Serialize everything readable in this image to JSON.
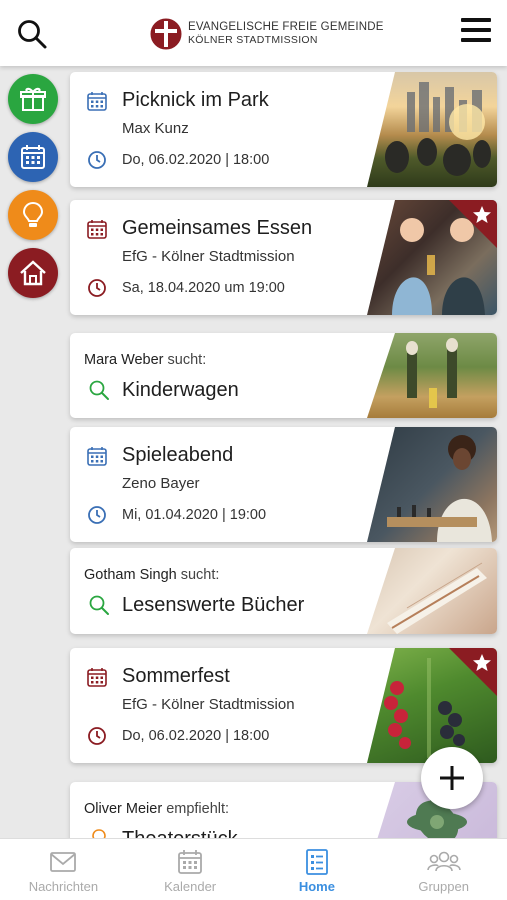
{
  "header": {
    "logo_line1": "EVANGELISCHE FREIE GEMEINDE",
    "logo_line2": "KÖLNER STADTMISSION",
    "colors": {
      "brand_red": "#8b1c22"
    }
  },
  "sidebar": [
    {
      "icon": "gift-icon",
      "color": "#2aa640"
    },
    {
      "icon": "calendar-icon",
      "color": "#2d64b3"
    },
    {
      "icon": "lightbulb-icon",
      "color": "#ef8b1a"
    },
    {
      "icon": "home-icon",
      "color": "#8b1c22"
    }
  ],
  "cards": [
    {
      "type": "event",
      "title": "Picknick im Park",
      "sub": "Max Kunz",
      "date": "Do, 06.02.2020 | 18:00",
      "accent": "#3a6fb5",
      "featured": false
    },
    {
      "type": "event",
      "title": "Gemeinsames Essen",
      "sub": "EfG - Kölner Stadtmission",
      "date": "Sa, 18.04.2020 um 19:00",
      "accent": "#8b1c22",
      "featured": true
    },
    {
      "type": "search",
      "who": "Mara Weber",
      "verb": "sucht:",
      "what": "Kinderwagen"
    },
    {
      "type": "event",
      "title": "Spieleabend",
      "sub": "Zeno Bayer",
      "date": "Mi, 01.04.2020 | 19:00",
      "accent": "#3a6fb5",
      "featured": false
    },
    {
      "type": "search",
      "who": "Gotham Singh",
      "verb": "sucht:",
      "what": "Lesenswerte Bücher"
    },
    {
      "type": "event",
      "title": "Sommerfest",
      "sub": "EfG - Kölner Stadtmission",
      "date": "Do, 06.02.2020 | 18:00",
      "accent": "#8b1c22",
      "featured": true
    },
    {
      "type": "recommend",
      "who": "Oliver Meier",
      "verb": "empfiehlt:",
      "what": "Theaterstück"
    }
  ],
  "tabs": [
    {
      "label": "Nachrichten",
      "icon": "mail-icon",
      "active": false
    },
    {
      "label": "Kalender",
      "icon": "calendar-icon",
      "active": false
    },
    {
      "label": "Home",
      "icon": "list-icon",
      "active": true
    },
    {
      "label": "Gruppen",
      "icon": "group-icon",
      "active": false
    }
  ],
  "colors": {
    "active_tab": "#3b8fe0",
    "search_green": "#2aa640",
    "recommend_orange": "#ef8b1a"
  }
}
